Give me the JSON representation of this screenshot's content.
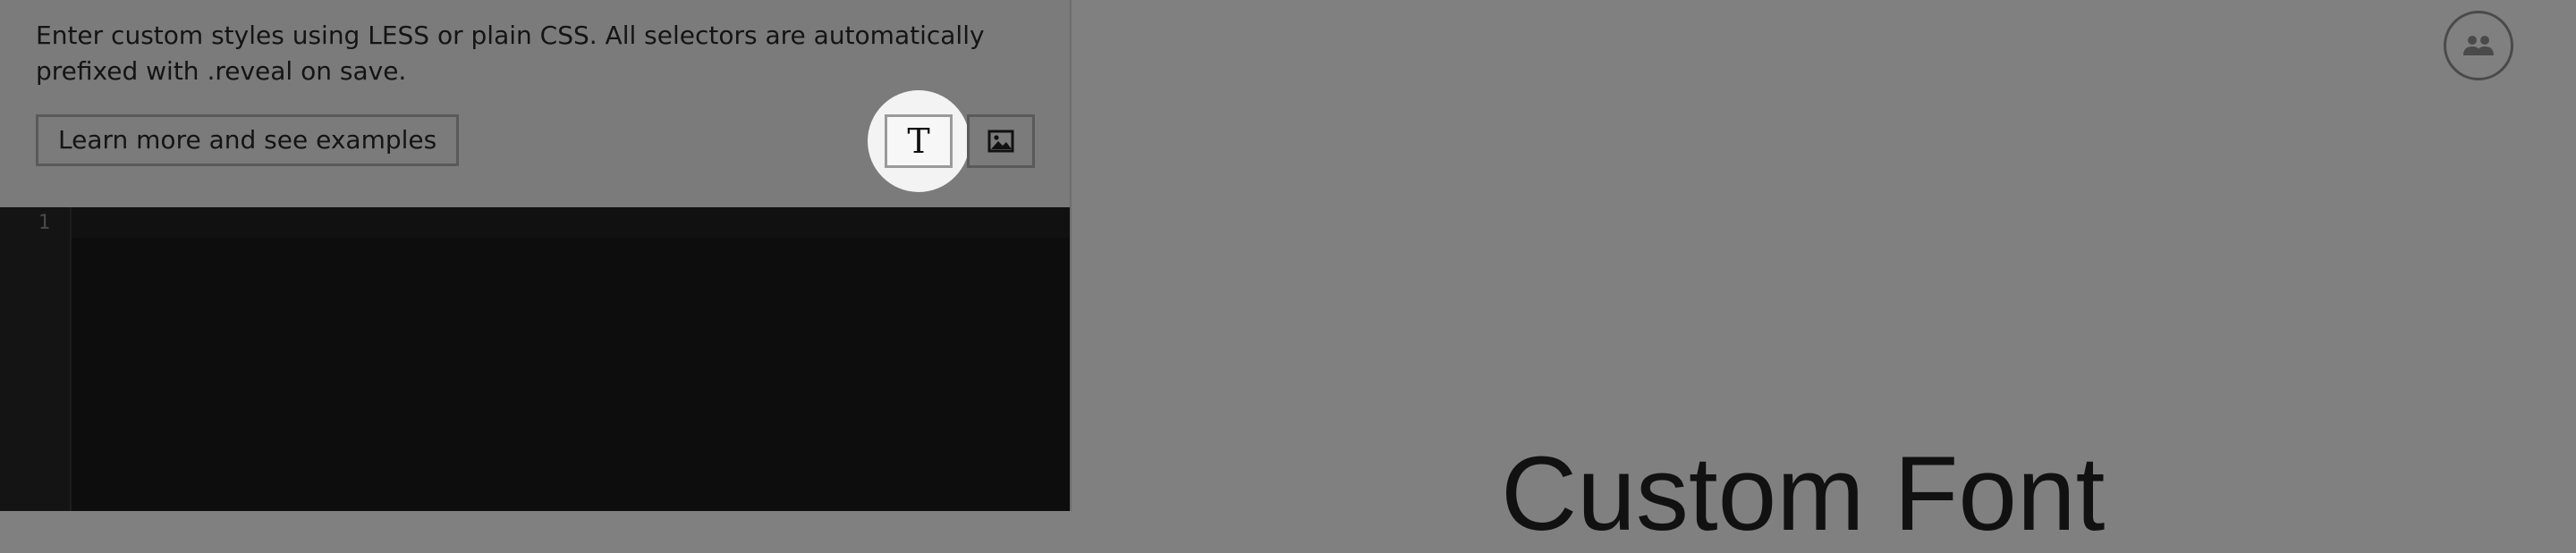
{
  "sidebar": {
    "description": "Enter custom styles using LESS or plain CSS. All selectors are automatically prefixed with .reveal on save.",
    "learn_more_label": "Learn more and see examples",
    "font_button_glyph": "T",
    "font_button_icon": "text-font-icon",
    "image_button_icon": "image-icon"
  },
  "editor": {
    "line_numbers": [
      "1"
    ]
  },
  "header": {
    "collaborators_icon": "users-icon"
  },
  "preview": {
    "title": "Custom Font"
  }
}
